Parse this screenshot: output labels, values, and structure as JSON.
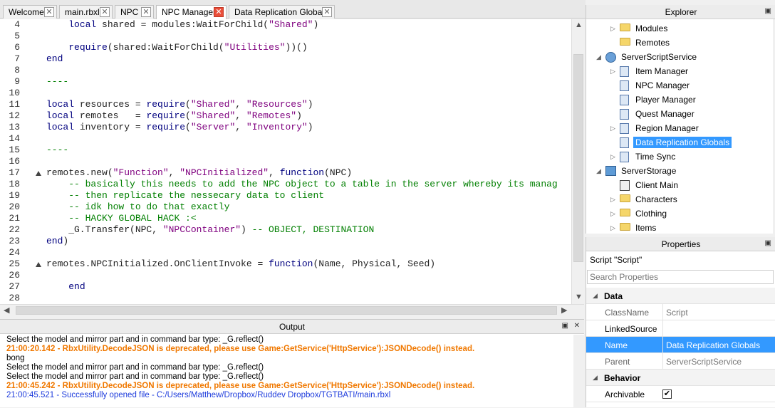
{
  "tabs": [
    {
      "label": "Welcome"
    },
    {
      "label": "main.rbxl"
    },
    {
      "label": "NPC"
    },
    {
      "label": "NPC Manager",
      "active": true
    },
    {
      "label": "Data Replication Globals"
    }
  ],
  "editor": {
    "line_numbers": [
      "4",
      "5",
      "6",
      "7",
      "8",
      "9",
      "10",
      "11",
      "12",
      "13",
      "14",
      "15",
      "16",
      "17",
      "18",
      "19",
      "20",
      "21",
      "22",
      "23",
      "24",
      "25",
      "26",
      "27",
      "28"
    ],
    "lines": [
      "    local shared = modules:WaitForChild(\"Shared\")",
      "",
      "    require(shared:WaitForChild(\"Utilities\"))()",
      "end",
      "",
      "----",
      "",
      "local resources = require(\"Shared\", \"Resources\")",
      "local remotes   = require(\"Shared\", \"Remotes\")",
      "local inventory = require(\"Server\", \"Inventory\")",
      "",
      "----",
      "",
      "remotes.new(\"Function\", \"NPCInitialized\", function(NPC)",
      "    -- basically this needs to add the NPC object to a table in the server whereby its manag",
      "    -- then replicate the nessecary data to client",
      "    -- idk how to do that exactly",
      "    -- HACKY GLOBAL HACK :<",
      "    _G.Transfer(NPC, \"NPCContainer\") -- OBJECT, DESTINATION",
      "end)",
      "",
      "remotes.NPCInitialized.OnClientInvoke = function(Name, Physical, Seed)",
      "",
      "    end",
      ""
    ]
  },
  "output": {
    "title": "Output",
    "lines": [
      {
        "text": "Select the model and mirror part and in command bar type:  _G.reflect()",
        "kind": "plain"
      },
      {
        "text": "21:00:20.142 - RbxUtility.DecodeJSON is deprecated, please use Game:GetService('HttpService'):JSONDecode() instead.",
        "kind": "warn"
      },
      {
        "text": "bong",
        "kind": "plain"
      },
      {
        "text": "Select the model and mirror part and in command bar type:  _G.reflect()",
        "kind": "plain"
      },
      {
        "text": "Select the model and mirror part and in command bar type:  _G.reflect()",
        "kind": "plain"
      },
      {
        "text": "21:00:45.242 - RbxUtility.DecodeJSON is deprecated, please use Game:GetService('HttpService'):JSONDecode() instead.",
        "kind": "warn"
      },
      {
        "text": "21:00:45.521 - Successfully opened file - C:/Users/Matthew/Dropbox/Ruddev Dropbox/TGTBATI/main.rbxl",
        "kind": "info"
      }
    ]
  },
  "explorer": {
    "title": "Explorer",
    "items": [
      {
        "label": "Modules",
        "icon": "folder-icon"
      },
      {
        "label": "Remotes",
        "icon": "folder-icon"
      },
      {
        "label": "ServerScriptService",
        "icon": "service-icon"
      },
      {
        "label": "Item Manager",
        "icon": "script-icon"
      },
      {
        "label": "NPC Manager",
        "icon": "script-icon"
      },
      {
        "label": "Player Manager",
        "icon": "script-icon"
      },
      {
        "label": "Quest Manager",
        "icon": "script-icon"
      },
      {
        "label": "Region Manager",
        "icon": "script-icon"
      },
      {
        "label": "Data Replication Globals",
        "icon": "script-icon",
        "selected": true
      },
      {
        "label": "Time Sync",
        "icon": "script-icon"
      },
      {
        "label": "ServerStorage",
        "icon": "storage-icon"
      },
      {
        "label": "Client Main",
        "icon": "localscript-icon"
      },
      {
        "label": "Characters",
        "icon": "folder-icon"
      },
      {
        "label": "Clothing",
        "icon": "folder-icon"
      },
      {
        "label": "Items",
        "icon": "folder-icon"
      }
    ]
  },
  "properties": {
    "title": "Properties",
    "selected_object": "Script \"Script\"",
    "search_placeholder": "Search Properties",
    "categories": {
      "data": "Data",
      "behavior": "Behavior"
    },
    "rows": [
      {
        "key": "ClassName",
        "value": "Script"
      },
      {
        "key": "LinkedSource",
        "value": ""
      },
      {
        "key": "Name",
        "value": "Data Replication Globals"
      },
      {
        "key": "Parent",
        "value": "ServerScriptService"
      },
      {
        "key": "Archivable",
        "value": "✔"
      }
    ]
  }
}
